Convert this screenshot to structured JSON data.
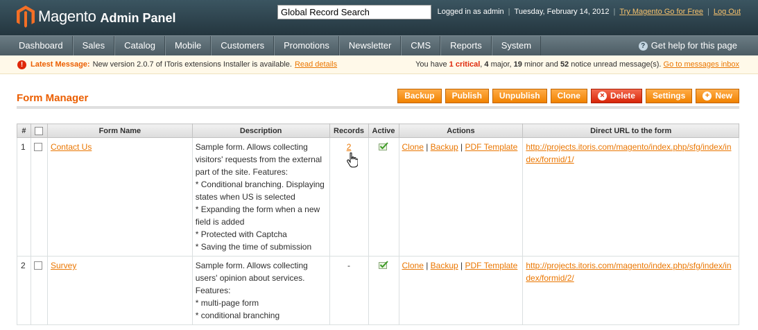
{
  "header": {
    "logo_text": "Magento",
    "logo_sub": "Admin Panel",
    "search_value": "Global Record Search",
    "logged_in": "Logged in as admin",
    "date": "Tuesday, February 14, 2012",
    "try_link": "Try Magento Go for Free",
    "logout": "Log Out"
  },
  "nav": {
    "items": [
      "Dashboard",
      "Sales",
      "Catalog",
      "Mobile",
      "Customers",
      "Promotions",
      "Newsletter",
      "CMS",
      "Reports",
      "System"
    ],
    "help": "Get help for this page"
  },
  "message": {
    "label": "Latest Message:",
    "text": "New version 2.0.7 of IToris extensions Installer is available.",
    "link": "Read details",
    "right_pre": "You have",
    "critical": "1 critical",
    "major_count": "4",
    "major": "major,",
    "minor_count": "19",
    "minor": "minor and",
    "notice_count": "52",
    "notice": "notice unread message(s).",
    "inbox": "Go to messages inbox"
  },
  "page": {
    "title": "Form Manager",
    "buttons": {
      "backup": "Backup",
      "publish": "Publish",
      "unpublish": "Unpublish",
      "clone": "Clone",
      "delete": "Delete",
      "settings": "Settings",
      "new": "New"
    }
  },
  "grid": {
    "headers": {
      "num": "#",
      "name": "Form Name",
      "desc": "Description",
      "records": "Records",
      "active": "Active",
      "actions": "Actions",
      "url": "Direct URL to the form"
    },
    "action_labels": {
      "clone": "Clone",
      "backup": "Backup",
      "pdf": "PDF Template"
    },
    "rows": [
      {
        "num": "1",
        "name": "Contact Us",
        "desc": "Sample form. Allows collecting visitors' requests from the external part of the site. Features:\n* Conditional branching. Displaying states when US is selected\n* Expanding the form when a new field is added\n* Protected with Captcha\n* Saving the time of submission",
        "records": "2",
        "url": "http://projects.itoris.com/magento/index.php/sfg/index/index/formid/1/"
      },
      {
        "num": "2",
        "name": "Survey",
        "desc": "Sample form. Allows collecting users' opinion about services. Features:\n* multi-page form\n* conditional branching",
        "records": "-",
        "url": "http://projects.itoris.com/magento/index.php/sfg/index/index/formid/2/"
      }
    ]
  },
  "colors": {
    "accent": "#eb5e00",
    "header_bg": "#2d444f",
    "button": "#f18200",
    "delete_button": "#d82508"
  }
}
